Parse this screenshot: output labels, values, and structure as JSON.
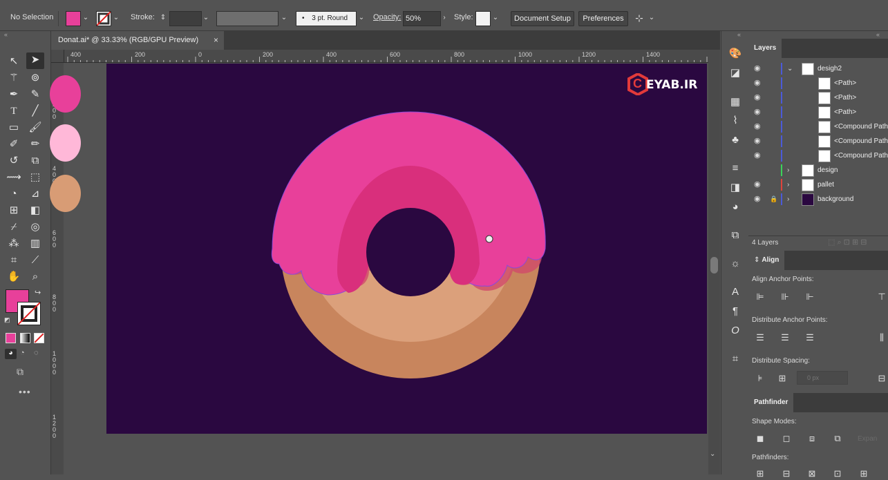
{
  "control_bar": {
    "selection_label": "No Selection",
    "stroke_label": "Stroke:",
    "brush_value": "3 pt. Round",
    "opacity_label": "Opacity:",
    "opacity_value": "50%",
    "style_label": "Style:",
    "document_setup": "Document Setup",
    "preferences": "Preferences",
    "fill_color": "#e8409a"
  },
  "document": {
    "tab_title": "Donat.ai* @ 33.33% (RGB/GPU Preview)",
    "close": "×"
  },
  "rulers": {
    "horizontal_ticks": [
      "400",
      "200",
      "0",
      "200",
      "400",
      "600",
      "800",
      "1000",
      "1200",
      "1400"
    ],
    "vertical_ticks": [
      "2\n0\n0",
      "4\n0\n0",
      "6\n0\n0",
      "8\n0\n0",
      "1\n0\n0\n0",
      "1\n2\n0\n0"
    ]
  },
  "artwork": {
    "watermark": "EYAB.IR",
    "watermark_prefix": "C",
    "artboard_color": "#2a0840",
    "icing_color": "#e8409a",
    "icing_shadow": "#d92f7c",
    "dough_light": "#dba07b",
    "dough_dark": "#c8855d",
    "pallet_colors": [
      "#e8409a",
      "#ffb8d8",
      "#d89c75"
    ]
  },
  "layers_panel": {
    "tab": "Layers",
    "rows": [
      {
        "name": "desigh2",
        "expanded": true,
        "visible": true,
        "color": "#4b5bd8"
      },
      {
        "name": "<Path>",
        "visible": true,
        "color": "#4b5bd8"
      },
      {
        "name": "<Path>",
        "visible": true,
        "color": "#4b5bd8"
      },
      {
        "name": "<Path>",
        "visible": true,
        "color": "#4b5bd8"
      },
      {
        "name": "<Compound Path>",
        "visible": true,
        "color": "#4b5bd8"
      },
      {
        "name": "<Compound Path>",
        "visible": true,
        "color": "#4b5bd8"
      },
      {
        "name": "<Compound Path>",
        "visible": true,
        "color": "#4b5bd8"
      },
      {
        "name": "design",
        "visible": false,
        "color": "#3ad35a"
      },
      {
        "name": "pallet",
        "visible": true,
        "color": "#e0443c"
      },
      {
        "name": "background",
        "visible": true,
        "locked": true,
        "color": "#4b5bd8"
      }
    ],
    "count": "4 Layers"
  },
  "align_panel": {
    "tab": "Align",
    "align_anchor_points": "Align Anchor Points:",
    "distribute_anchor_points": "Distribute Anchor Points:",
    "distribute_spacing": "Distribute Spacing:",
    "spacing_value": "0 px"
  },
  "pathfinder_panel": {
    "tab": "Pathfinder",
    "shape_modes": "Shape Modes:",
    "pathfinders": "Pathfinders:",
    "expand": "Expan"
  }
}
